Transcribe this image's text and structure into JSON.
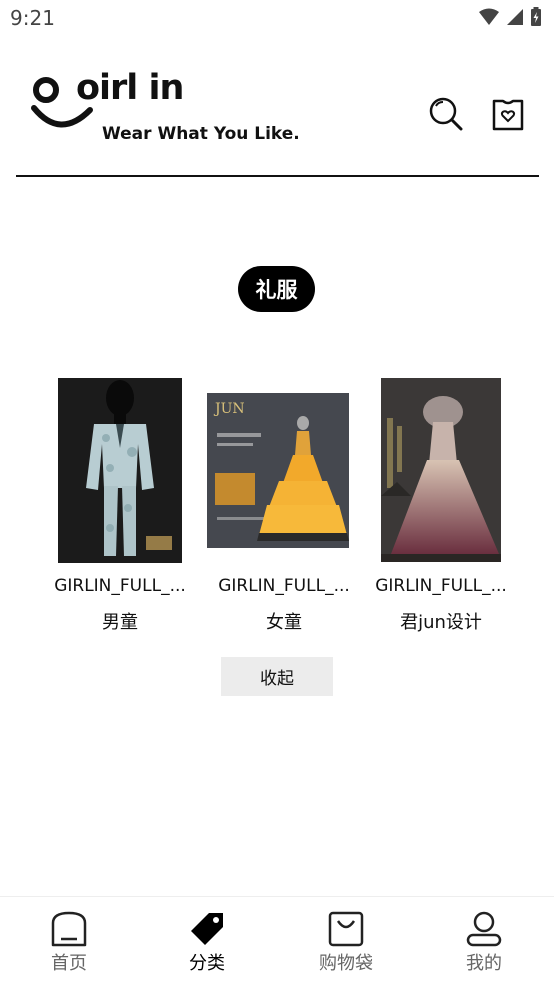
{
  "status": {
    "time": "9:21"
  },
  "header": {
    "logo_word": "oirl in",
    "logo_tagline": "Wear What You Like."
  },
  "category": {
    "title": "礼服"
  },
  "products": [
    {
      "name": "GIRLIN_FULL_...",
      "subtitle": "男童"
    },
    {
      "name": "GIRLIN_FULL_...",
      "subtitle": "女童"
    },
    {
      "name": "GIRLIN_FULL_...",
      "subtitle": "君jun设计"
    }
  ],
  "collapse_label": "收起",
  "nav": [
    {
      "label": "首页",
      "icon": "home-icon"
    },
    {
      "label": "分类",
      "icon": "tag-icon",
      "active": true
    },
    {
      "label": "购物袋",
      "icon": "shopping-bag-icon"
    },
    {
      "label": "我的",
      "icon": "profile-icon"
    }
  ],
  "colors": {
    "accent": "#000000",
    "nav_inactive": "#666666",
    "button_bg": "#ececec"
  }
}
